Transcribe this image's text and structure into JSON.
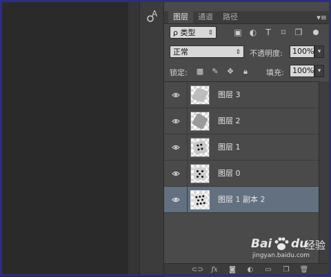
{
  "tool_strip": {
    "tool_icon": "character-panel-icon"
  },
  "panel": {
    "tabs": [
      {
        "label": "图层",
        "active": true
      },
      {
        "label": "通道",
        "active": false
      },
      {
        "label": "路径",
        "active": false
      }
    ],
    "menu_icon": "panel-menu-icon",
    "filter": {
      "kind_label": "ρ 类型",
      "icons": [
        "pixel-filter-icon",
        "adjustment-filter-icon",
        "type-filter-icon",
        "shape-filter-icon",
        "smart-object-filter-icon"
      ]
    },
    "blend": {
      "mode": "正常",
      "opacity_label": "不透明度:",
      "opacity": "100%"
    },
    "lock": {
      "label": "锁定:",
      "icons": [
        "lock-transparent-icon",
        "lock-image-icon",
        "lock-position-icon",
        "lock-all-icon"
      ],
      "fill_label": "填充:",
      "fill": "100%"
    },
    "layers": [
      {
        "name": "图层 3",
        "visible": true,
        "selected": false
      },
      {
        "name": "图层 2",
        "visible": true,
        "selected": false
      },
      {
        "name": "图层 1",
        "visible": true,
        "selected": false
      },
      {
        "name": "图层 0",
        "visible": true,
        "selected": false
      },
      {
        "name": "图层 1 副本 2",
        "visible": true,
        "selected": true
      }
    ],
    "bottom_icons": [
      "link-layers-icon",
      "fx-icon",
      "add-mask-icon",
      "adjustment-layer-icon",
      "new-group-icon",
      "new-layer-icon",
      "delete-layer-icon"
    ],
    "fx_label": "fx"
  },
  "watermark": {
    "brand_left": "Bai",
    "brand_right": "du",
    "brand_cn": "经验",
    "url": "jingyan.baidu.com"
  },
  "colors": {
    "selected_row": "#627080",
    "panel_bg": "#4a4a4a",
    "frame": "#2d2e7d"
  }
}
